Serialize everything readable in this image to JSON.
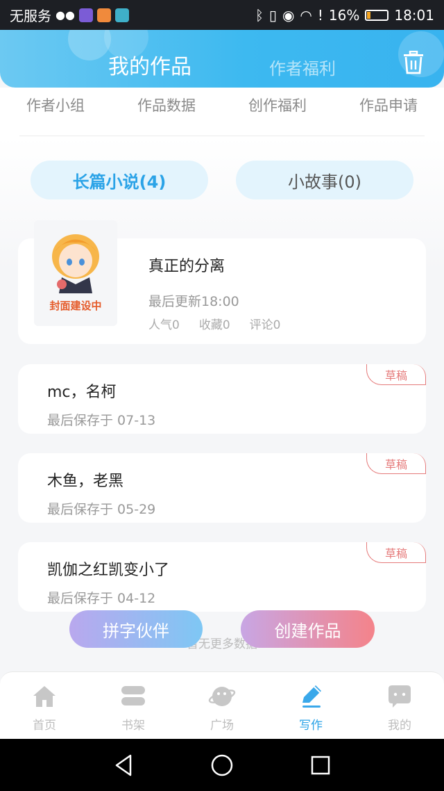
{
  "status_bar": {
    "carrier": "无服务",
    "battery": "16%",
    "battery_level": 0.16,
    "time": "18:01"
  },
  "header": {
    "tab_active": "我的作品",
    "tab_inactive": "作者福利",
    "trash_icon": "trash-icon"
  },
  "links": [
    "作者小组",
    "作品数据",
    "创作福利",
    "作品申请"
  ],
  "category_tabs": [
    {
      "label": "长篇小说(4)",
      "active": true
    },
    {
      "label": "小故事(0)",
      "active": false
    }
  ],
  "novel": {
    "cover_text": "封面建设中",
    "title": "真正的分离",
    "last_update": "最后更新18:00",
    "stats": [
      "人气0",
      "收藏0",
      "评论0"
    ]
  },
  "drafts": [
    {
      "title": "mc，名柯",
      "saved": "最后保存于 07-13",
      "badge": "草稿"
    },
    {
      "title": "木鱼，老黑",
      "saved": "最后保存于 05-29",
      "badge": "草稿"
    },
    {
      "title": "凯伽之红凯变小了",
      "saved": "最后保存于 04-12",
      "badge": "草稿"
    }
  ],
  "no_more": "暂无更多数据",
  "fab": {
    "partner": "拼字伙伴",
    "create": "创建作品"
  },
  "bottom_nav": [
    {
      "label": "首页",
      "icon": "home-icon",
      "active": false
    },
    {
      "label": "书架",
      "icon": "bookshelf-icon",
      "active": false
    },
    {
      "label": "广场",
      "icon": "planet-icon",
      "active": false
    },
    {
      "label": "写作",
      "icon": "pen-icon",
      "active": true
    },
    {
      "label": "我的",
      "icon": "chat-face-icon",
      "active": false
    }
  ],
  "colors": {
    "accent": "#2ba3e7",
    "draft_badge": "#e57a7a",
    "header_gradient_start": "#6cc9f2",
    "header_gradient_end": "#38b3ef"
  }
}
